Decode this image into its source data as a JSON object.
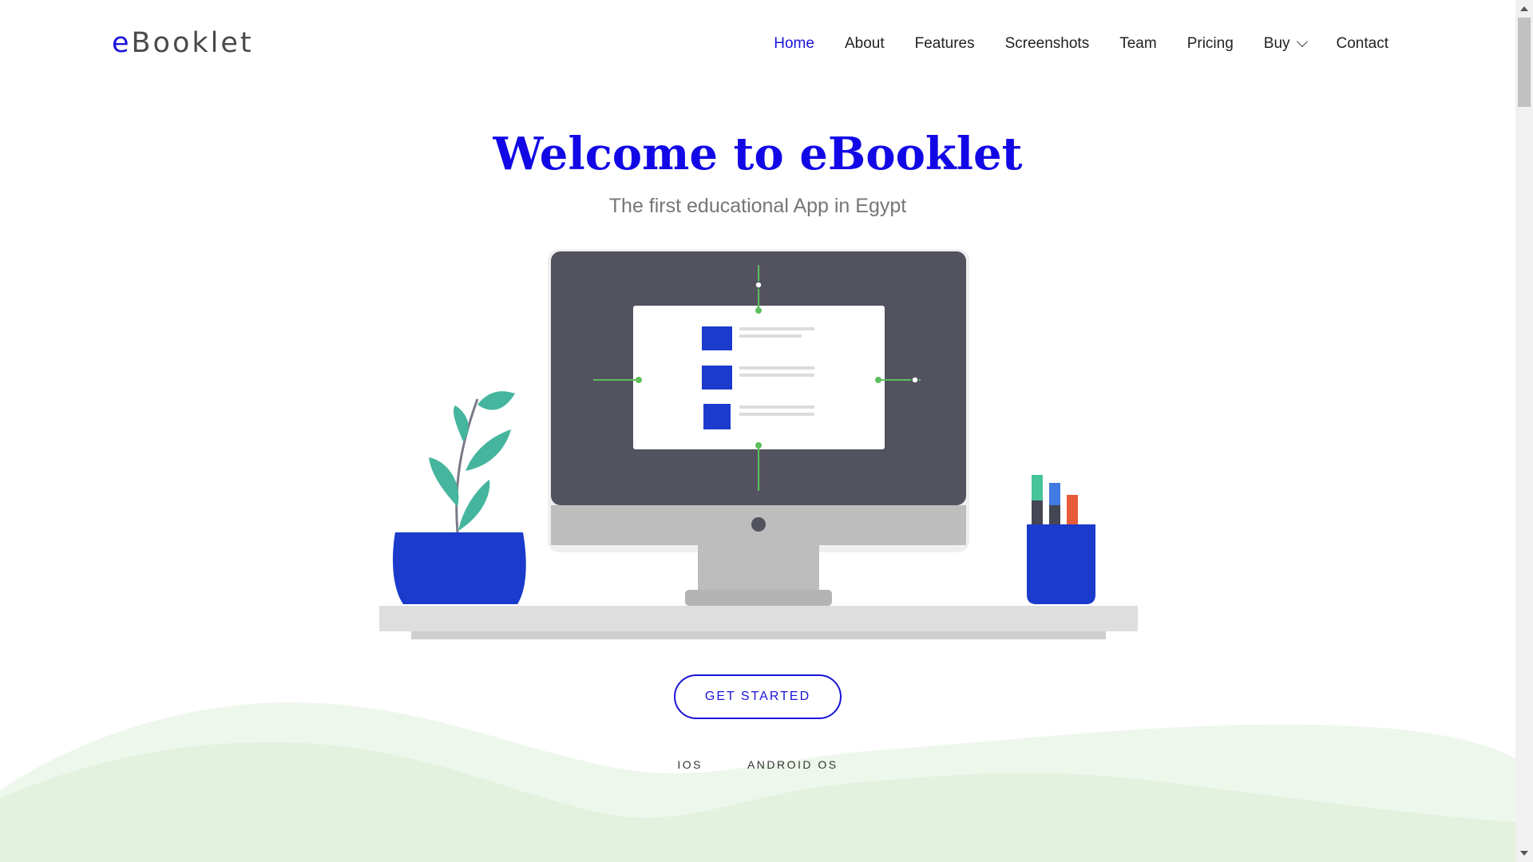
{
  "brand": {
    "logo_first": "e",
    "logo_rest": "Booklet",
    "accent_color": "#1a14d9"
  },
  "nav": {
    "items": [
      {
        "label": "Home",
        "active": true
      },
      {
        "label": "About"
      },
      {
        "label": "Features"
      },
      {
        "label": "Screenshots"
      },
      {
        "label": "Team"
      },
      {
        "label": "Pricing"
      },
      {
        "label": "Buy",
        "dropdown": true
      },
      {
        "label": "Contact"
      }
    ]
  },
  "hero": {
    "title": "Welcome to eBooklet",
    "subtitle": "The first educational App in Egypt",
    "cta_label": "GET STARTED",
    "store_links": [
      "IOS",
      "ANDROID OS"
    ]
  },
  "icons": {
    "dropdown": "chevron-down-icon",
    "illustration": "desk-monitor-illustration"
  },
  "colors": {
    "title": "#1208e6",
    "hill_light": "#eef7ec",
    "hill_mid": "#e4f2e0",
    "monitor": "#52535f",
    "pot": "#1a3bcc"
  }
}
